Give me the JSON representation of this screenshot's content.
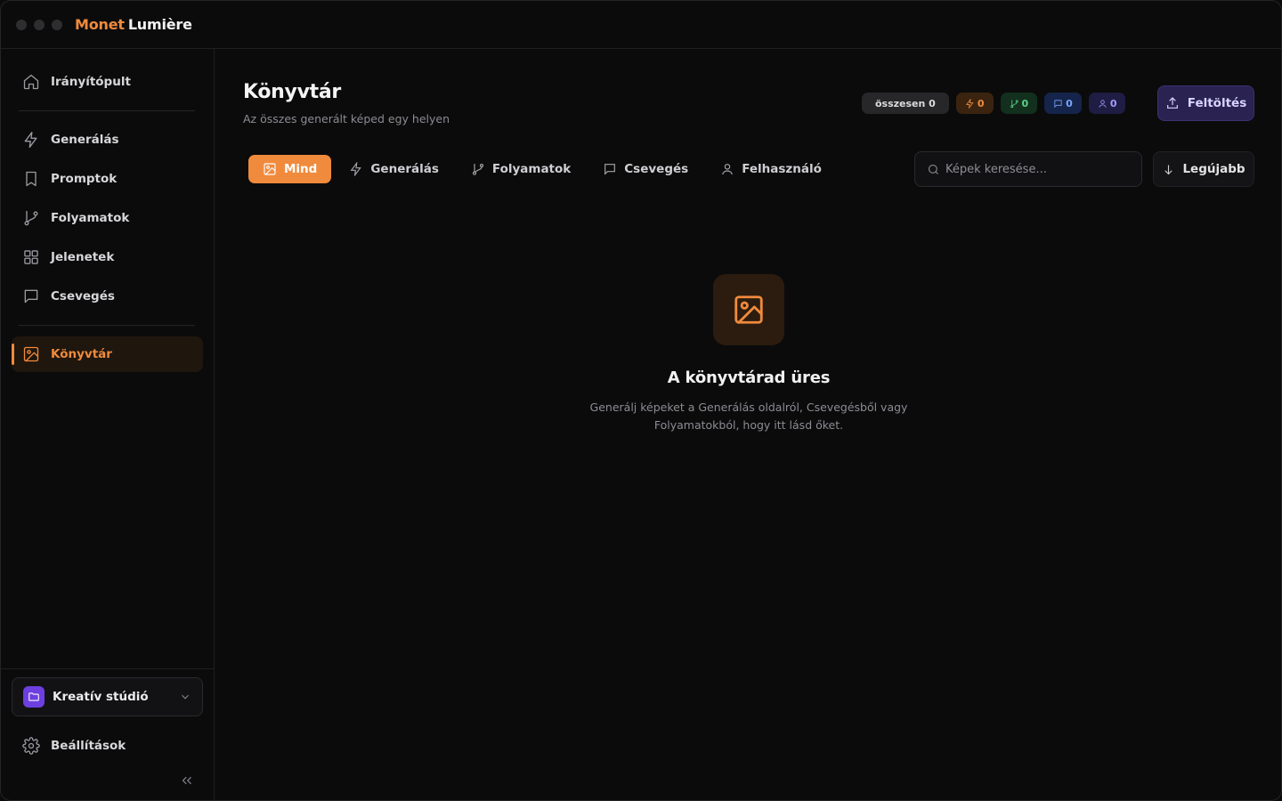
{
  "app": {
    "brand_part1": "Monet",
    "brand_part2": "Lumière",
    "accent_color": "#f08a3c"
  },
  "sidebar": {
    "items": [
      {
        "label": "Irányítópult",
        "icon": "home-icon"
      },
      {
        "label": "Generálás",
        "icon": "lightning-icon"
      },
      {
        "label": "Promptok",
        "icon": "bookmark-icon"
      },
      {
        "label": "Folyamatok",
        "icon": "git-branch-icon"
      },
      {
        "label": "Jelenetek",
        "icon": "grid-icon"
      },
      {
        "label": "Csevegés",
        "icon": "chat-icon"
      },
      {
        "label": "Könyvtár",
        "icon": "image-icon",
        "active": true
      }
    ],
    "workspace": {
      "label": "Kreatív stúdió",
      "icon": "folder-icon"
    },
    "settings_label": "Beállítások"
  },
  "header": {
    "title": "Könyvtár",
    "subtitle": "Az összes generált képed egy helyen",
    "stats": {
      "total": "összesen 0",
      "generation": "0",
      "flows": "0",
      "chat": "0",
      "user": "0"
    },
    "upload_label": "Feltöltés"
  },
  "filters": [
    {
      "label": "Mind",
      "icon": "image-icon",
      "active": true
    },
    {
      "label": "Generálás",
      "icon": "lightning-icon"
    },
    {
      "label": "Folyamatok",
      "icon": "git-branch-icon"
    },
    {
      "label": "Csevegés",
      "icon": "chat-icon"
    },
    {
      "label": "Felhasználó",
      "icon": "user-icon"
    }
  ],
  "search": {
    "placeholder": "Képek keresése..."
  },
  "sort": {
    "label": "Legújabb"
  },
  "empty_state": {
    "title": "A könyvtárad üres",
    "description": "Generálj képeket a Generálás oldalról, Csevegésből vagy Folyamatokból, hogy itt lásd őket."
  }
}
